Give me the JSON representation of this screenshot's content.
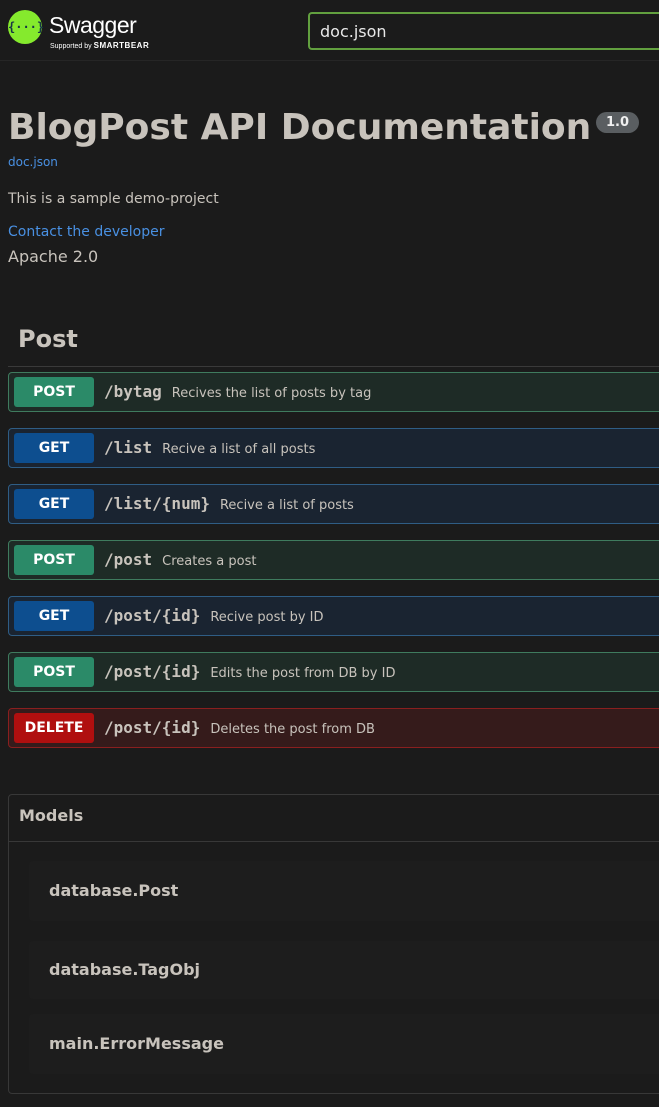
{
  "header": {
    "logo": {
      "icon_text": "{···}",
      "wordmark": "Swagger",
      "tagline_prefix": "Supported by",
      "tagline_brand": "SMARTBEAR",
      "icon_color": "#85ea2d"
    },
    "search": {
      "value": "doc.json",
      "border_color": "#62a03f"
    }
  },
  "info": {
    "title": "BlogPost API Documentation",
    "version": "1.0",
    "doc_link": "doc.json",
    "description": "This is a sample demo-project",
    "contact_link": "Contact the developer",
    "license": "Apache 2.0"
  },
  "tag": {
    "name": "Post",
    "operations": [
      {
        "method": "POST",
        "path": "/bytag",
        "summary": "Recives the list of posts by tag"
      },
      {
        "method": "GET",
        "path": "/list",
        "summary": "Recive a list of all posts"
      },
      {
        "method": "GET",
        "path": "/list/{num}",
        "summary": "Recive a list of posts"
      },
      {
        "method": "POST",
        "path": "/post",
        "summary": "Creates a post"
      },
      {
        "method": "GET",
        "path": "/post/{id}",
        "summary": "Recive post by ID"
      },
      {
        "method": "POST",
        "path": "/post/{id}",
        "summary": "Edits the post from DB by ID"
      },
      {
        "method": "DELETE",
        "path": "/post/{id}",
        "summary": "Deletes the post from DB"
      }
    ]
  },
  "models": {
    "title": "Models",
    "items": [
      "database.Post",
      "database.TagObj",
      "main.ErrorMessage"
    ]
  },
  "colors": {
    "post": "#2b8a68",
    "get": "#0d4e8f",
    "delete": "#b00f0f",
    "link": "#4990e2",
    "background": "#1b1b1b"
  }
}
